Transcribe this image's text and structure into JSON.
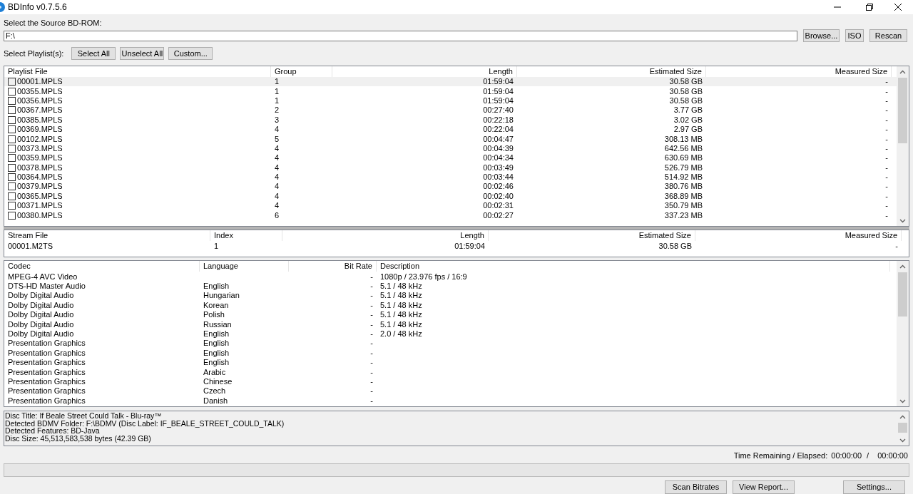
{
  "window": {
    "title": "BDInfo v0.7.5.6"
  },
  "source": {
    "label": "Select the Source BD-ROM:",
    "value": "F:\\",
    "buttons": [
      "Browse...",
      "ISO",
      "Rescan"
    ]
  },
  "playlist_select": {
    "label": "Select Playlist(s):",
    "buttons": [
      "Select All",
      "Unselect All",
      "Custom..."
    ]
  },
  "playlists": {
    "columns": [
      "Playlist File",
      "Group",
      "Length",
      "Estimated Size",
      "Measured Size"
    ],
    "rows": [
      {
        "cells": [
          "00001.MPLS",
          "1",
          "01:59:04",
          "30.58 GB",
          "-"
        ],
        "checked": false,
        "selected": true
      },
      {
        "cells": [
          "00355.MPLS",
          "1",
          "01:59:04",
          "30.58 GB",
          "-"
        ],
        "checked": false,
        "selected": false
      },
      {
        "cells": [
          "00356.MPLS",
          "1",
          "01:59:04",
          "30.58 GB",
          "-"
        ],
        "checked": false,
        "selected": false
      },
      {
        "cells": [
          "00367.MPLS",
          "2",
          "00:27:40",
          "3.77 GB",
          "-"
        ],
        "checked": false,
        "selected": false
      },
      {
        "cells": [
          "00385.MPLS",
          "3",
          "00:22:18",
          "3.02 GB",
          "-"
        ],
        "checked": false,
        "selected": false
      },
      {
        "cells": [
          "00369.MPLS",
          "4",
          "00:22:04",
          "2.97 GB",
          "-"
        ],
        "checked": false,
        "selected": false
      },
      {
        "cells": [
          "00102.MPLS",
          "5",
          "00:04:47",
          "308.13 MB",
          "-"
        ],
        "checked": false,
        "selected": false
      },
      {
        "cells": [
          "00373.MPLS",
          "4",
          "00:04:39",
          "642.56 MB",
          "-"
        ],
        "checked": false,
        "selected": false
      },
      {
        "cells": [
          "00359.MPLS",
          "4",
          "00:04:34",
          "630.69 MB",
          "-"
        ],
        "checked": false,
        "selected": false
      },
      {
        "cells": [
          "00378.MPLS",
          "4",
          "00:03:49",
          "526.79 MB",
          "-"
        ],
        "checked": false,
        "selected": false
      },
      {
        "cells": [
          "00364.MPLS",
          "4",
          "00:03:44",
          "514.92 MB",
          "-"
        ],
        "checked": false,
        "selected": false
      },
      {
        "cells": [
          "00379.MPLS",
          "4",
          "00:02:46",
          "380.76 MB",
          "-"
        ],
        "checked": false,
        "selected": false
      },
      {
        "cells": [
          "00365.MPLS",
          "4",
          "00:02:40",
          "368.89 MB",
          "-"
        ],
        "checked": false,
        "selected": false
      },
      {
        "cells": [
          "00371.MPLS",
          "4",
          "00:02:31",
          "350.79 MB",
          "-"
        ],
        "checked": false,
        "selected": false
      },
      {
        "cells": [
          "00380.MPLS",
          "6",
          "00:02:27",
          "337.23 MB",
          "-"
        ],
        "checked": false,
        "selected": false
      }
    ]
  },
  "streams": {
    "columns": [
      "Stream File",
      "Index",
      "Length",
      "Estimated Size",
      "Measured Size"
    ],
    "rows": [
      [
        "00001.M2TS",
        "1",
        "01:59:04",
        "30.58 GB",
        "-"
      ]
    ]
  },
  "codecs": {
    "columns": [
      "Codec",
      "Language",
      "Bit Rate",
      "Description"
    ],
    "rows": [
      [
        "MPEG-4 AVC Video",
        "",
        "-",
        "1080p / 23.976 fps / 16:9"
      ],
      [
        "DTS-HD Master Audio",
        "English",
        "-",
        "5.1 / 48 kHz"
      ],
      [
        "Dolby Digital Audio",
        "Hungarian",
        "-",
        "5.1 / 48 kHz"
      ],
      [
        "Dolby Digital Audio",
        "Korean",
        "-",
        "5.1 / 48 kHz"
      ],
      [
        "Dolby Digital Audio",
        "Polish",
        "-",
        "5.1 / 48 kHz"
      ],
      [
        "Dolby Digital Audio",
        "Russian",
        "-",
        "5.1 / 48 kHz"
      ],
      [
        "Dolby Digital Audio",
        "English",
        "-",
        "2.0 / 48 kHz"
      ],
      [
        "Presentation Graphics",
        "English",
        "-",
        ""
      ],
      [
        "Presentation Graphics",
        "English",
        "-",
        ""
      ],
      [
        "Presentation Graphics",
        "English",
        "-",
        ""
      ],
      [
        "Presentation Graphics",
        "Arabic",
        "-",
        ""
      ],
      [
        "Presentation Graphics",
        "Chinese",
        "-",
        ""
      ],
      [
        "Presentation Graphics",
        "Czech",
        "-",
        ""
      ],
      [
        "Presentation Graphics",
        "Danish",
        "-",
        ""
      ]
    ]
  },
  "info_lines": [
    "Disc Title: If Beale Street Could Talk - Blu-ray™",
    "Detected BDMV Folder: F:\\BDMV (Disc Label: IF_BEALE_STREET_COULD_TALK)",
    "Detected Features: BD-Java",
    "Disc Size: 45,513,583,538 bytes (42.39 GB)"
  ],
  "time": {
    "label": "Time Remaining / Elapsed:",
    "remaining": "00:00:00",
    "separator": "/",
    "elapsed": "00:00:00"
  },
  "progress": {
    "level": 0
  },
  "bottom_buttons": [
    "Scan Bitrates",
    "View Report...",
    "Settings..."
  ]
}
